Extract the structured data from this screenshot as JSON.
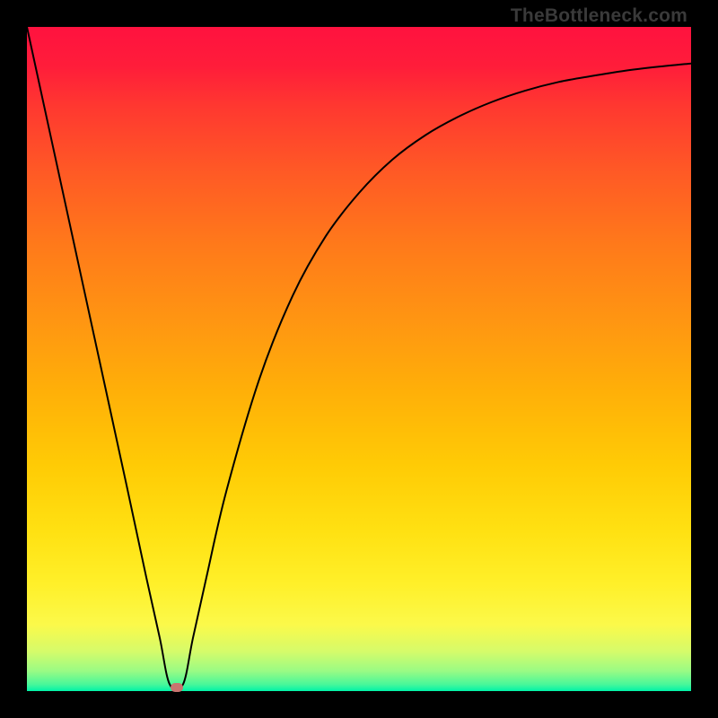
{
  "attribution": "TheBottleneck.com",
  "chart_data": {
    "type": "line",
    "title": "",
    "xlabel": "",
    "ylabel": "",
    "xlim": [
      0,
      100
    ],
    "ylim": [
      0,
      100
    ],
    "background_gradient": {
      "type": "vertical",
      "stops": [
        {
          "pos": 0,
          "color": "#ff123f"
        },
        {
          "pos": 50,
          "color": "#ffb008"
        },
        {
          "pos": 90,
          "color": "#fbf94a"
        },
        {
          "pos": 100,
          "color": "#00f3a8"
        }
      ]
    },
    "series": [
      {
        "name": "bottleneck-curve",
        "x": [
          0,
          5,
          10,
          15,
          18,
          20,
          21.5,
          23.5,
          25,
          27,
          30,
          35,
          40,
          45,
          50,
          55,
          60,
          65,
          70,
          75,
          80,
          85,
          90,
          95,
          100
        ],
        "y": [
          100,
          77,
          54,
          31,
          17,
          8,
          1,
          1,
          8,
          17,
          30,
          47,
          59.5,
          68.5,
          75,
          80,
          83.7,
          86.5,
          88.7,
          90.4,
          91.7,
          92.6,
          93.4,
          94,
          94.5
        ]
      }
    ],
    "marker": {
      "x": 22.5,
      "y": 0.5,
      "color": "#c9746f"
    }
  }
}
